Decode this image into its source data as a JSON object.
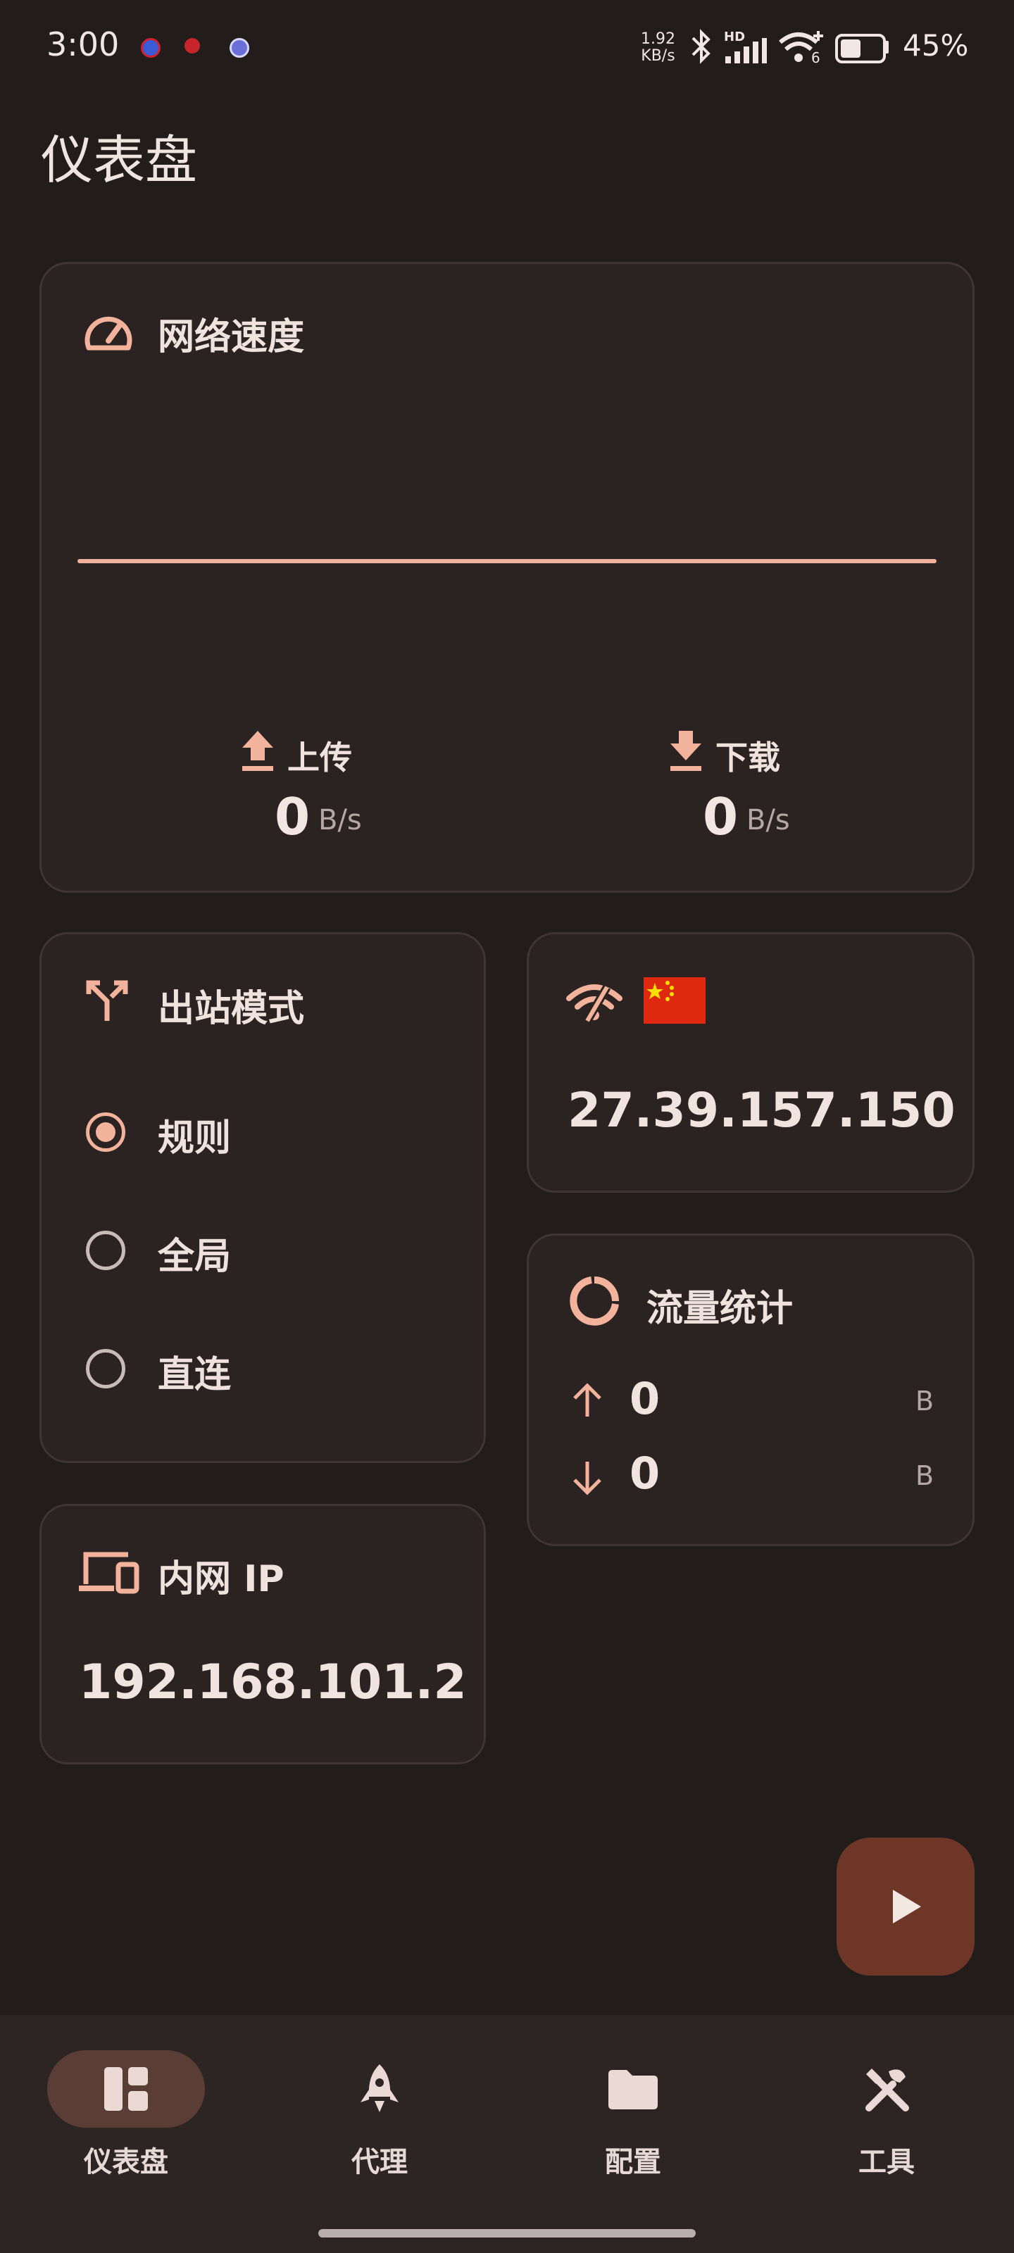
{
  "status_bar": {
    "time": "3:00",
    "net_rate": "1.92",
    "net_rate_unit": "KB/s",
    "signal_badge": "HD",
    "wifi_badge": "6",
    "battery": "45%"
  },
  "page_title": "仪表盘",
  "speed_card": {
    "title": "网络速度",
    "upload_label": "上传",
    "upload_value": "0",
    "upload_unit": "B/s",
    "download_label": "下载",
    "download_value": "0",
    "download_unit": "B/s"
  },
  "mode_card": {
    "title": "出站模式",
    "options": [
      {
        "label": "规则",
        "selected": true
      },
      {
        "label": "全局",
        "selected": false
      },
      {
        "label": "直连",
        "selected": false
      }
    ]
  },
  "ip_card": {
    "ip": "27.39.157.150",
    "flag_icon": "china-flag-icon"
  },
  "traffic_card": {
    "title": "流量统计",
    "up_value": "0",
    "up_unit": "B",
    "down_value": "0",
    "down_unit": "B"
  },
  "lan_card": {
    "title": "内网 IP",
    "ip": "192.168.101.2"
  },
  "nav": {
    "items": [
      {
        "label": "仪表盘",
        "icon": "dashboard-icon",
        "active": true
      },
      {
        "label": "代理",
        "icon": "rocket-icon",
        "active": false
      },
      {
        "label": "配置",
        "icon": "folder-icon",
        "active": false
      },
      {
        "label": "工具",
        "icon": "tools-icon",
        "active": false
      }
    ]
  },
  "colors": {
    "background": "#221c1b",
    "card": "#2a2322",
    "accent": "#f2b29b",
    "fab": "#6e3626",
    "nav_active": "#5a3d35"
  }
}
